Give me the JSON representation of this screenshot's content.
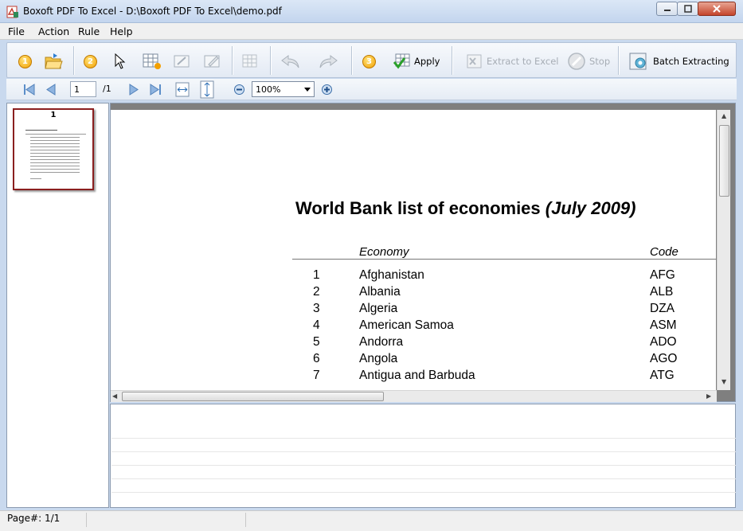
{
  "window": {
    "title": "Boxoft PDF To Excel - D:\\Boxoft PDF To Excel\\demo.pdf"
  },
  "menu": {
    "items": [
      {
        "label": "File"
      },
      {
        "label": "Action"
      },
      {
        "label": "Rule"
      },
      {
        "label": "Help"
      }
    ]
  },
  "toolbar": {
    "step1": "1",
    "step2": "2",
    "step3": "3",
    "apply_label": "Apply",
    "extract_label": "Extract to Excel",
    "stop_label": "Stop",
    "batch_label": "Batch Extracting"
  },
  "nav": {
    "page_value": "1",
    "page_total": "/1",
    "zoom_value": "100%"
  },
  "thumbnails": [
    {
      "label": "1"
    }
  ],
  "document": {
    "title_main": "World Bank list of economies ",
    "title_italic": "(July 2009)",
    "col_economy": "Economy",
    "col_code": "Code",
    "rows": [
      {
        "num": "1",
        "name": "Afghanistan",
        "code": "AFG"
      },
      {
        "num": "2",
        "name": "Albania",
        "code": "ALB"
      },
      {
        "num": "3",
        "name": "Algeria",
        "code": "DZA"
      },
      {
        "num": "4",
        "name": "American Samoa",
        "code": "ASM"
      },
      {
        "num": "5",
        "name": "Andorra",
        "code": "ADO"
      },
      {
        "num": "6",
        "name": "Angola",
        "code": "AGO"
      },
      {
        "num": "7",
        "name": "Antigua and Barbuda",
        "code": "ATG"
      }
    ]
  },
  "status": {
    "page_info": "Page#: 1/1"
  },
  "colors": {
    "accent": "#f3a000",
    "thumb_border": "#8a1f1f",
    "chrome": "#c9d9ee"
  }
}
